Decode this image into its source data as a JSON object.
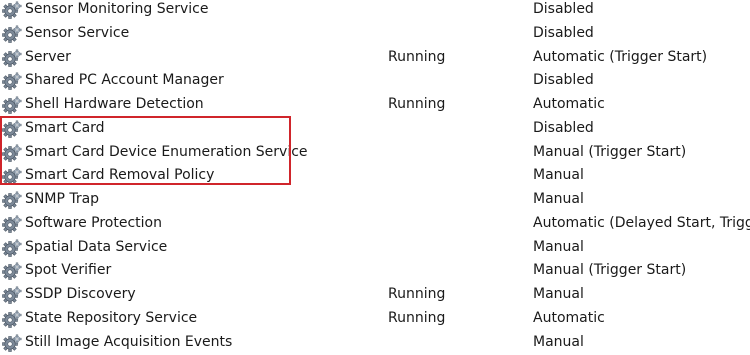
{
  "services": [
    {
      "name": "Sensor Monitoring Service",
      "status": "",
      "startup": "Disabled"
    },
    {
      "name": "Sensor Service",
      "status": "",
      "startup": "Disabled"
    },
    {
      "name": "Server",
      "status": "Running",
      "startup": "Automatic (Trigger Start)"
    },
    {
      "name": "Shared PC Account Manager",
      "status": "",
      "startup": "Disabled"
    },
    {
      "name": "Shell Hardware Detection",
      "status": "Running",
      "startup": "Automatic"
    },
    {
      "name": "Smart Card",
      "status": "",
      "startup": "Disabled"
    },
    {
      "name": "Smart Card Device Enumeration Service",
      "status": "",
      "startup": "Manual (Trigger Start)"
    },
    {
      "name": "Smart Card Removal Policy",
      "status": "",
      "startup": "Manual"
    },
    {
      "name": "SNMP Trap",
      "status": "",
      "startup": "Manual"
    },
    {
      "name": "Software Protection",
      "status": "",
      "startup": "Automatic (Delayed Start, Trigger S"
    },
    {
      "name": "Spatial Data Service",
      "status": "",
      "startup": "Manual"
    },
    {
      "name": "Spot Verifier",
      "status": "",
      "startup": "Manual (Trigger Start)"
    },
    {
      "name": "SSDP Discovery",
      "status": "Running",
      "startup": "Manual"
    },
    {
      "name": "State Repository Service",
      "status": "Running",
      "startup": "Automatic"
    },
    {
      "name": "Still Image Acquisition Events",
      "status": "",
      "startup": "Manual"
    }
  ],
  "icon": "service-gear-icon",
  "highlight_color": "#d0252b"
}
